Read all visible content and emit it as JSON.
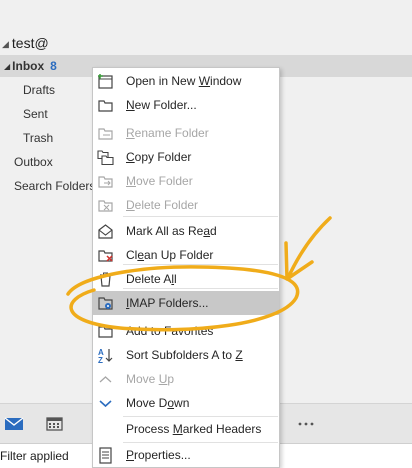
{
  "folders": {
    "account": "test@",
    "inbox_label": "Inbox",
    "inbox_count": "8",
    "drafts": "Drafts",
    "sent": "Sent",
    "trash": "Trash",
    "outbox": "Outbox",
    "search_folders": "Search Folders"
  },
  "status": {
    "filter": "Filter applied"
  },
  "menu": {
    "items": [
      {
        "pre": "Open in New ",
        "acc": "W",
        "post": "indow",
        "icon": "open-window-icon",
        "disabled": false
      },
      {
        "pre": "",
        "acc": "N",
        "post": "ew Folder...",
        "icon": "new-folder-icon",
        "disabled": false
      },
      {
        "pre": "",
        "acc": "R",
        "post": "ename Folder",
        "icon": "rename-folder-icon",
        "disabled": true
      },
      {
        "pre": "",
        "acc": "C",
        "post": "opy Folder",
        "icon": "copy-folder-icon",
        "disabled": false
      },
      {
        "pre": "",
        "acc": "M",
        "post": "ove Folder",
        "icon": "move-folder-icon",
        "disabled": true
      },
      {
        "pre": "",
        "acc": "D",
        "post": "elete Folder",
        "icon": "delete-folder-icon",
        "disabled": true
      },
      {
        "pre": "Mark All as Re",
        "acc": "a",
        "post": "d",
        "icon": "mark-read-icon",
        "disabled": false
      },
      {
        "pre": "Cl",
        "acc": "e",
        "post": "an Up Folder",
        "icon": "clean-up-icon",
        "disabled": false
      },
      {
        "pre": "Delete A",
        "acc": "l",
        "post": "l",
        "icon": "delete-all-icon",
        "disabled": false
      },
      {
        "pre": "",
        "acc": "I",
        "post": "MAP Folders...",
        "icon": "imap-folders-icon",
        "disabled": false
      },
      {
        "pre": "Add to Favorites",
        "acc": "",
        "post": "",
        "icon": "favorites-icon",
        "disabled": false
      },
      {
        "pre": "Sort Subfolders A to ",
        "acc": "Z",
        "post": "",
        "icon": "sort-az-icon",
        "disabled": false
      },
      {
        "pre": "Move ",
        "acc": "U",
        "post": "p",
        "icon": "chevron-up-icon",
        "disabled": true
      },
      {
        "pre": "Move D",
        "acc": "o",
        "post": "wn",
        "icon": "chevron-down-icon",
        "disabled": false
      },
      {
        "pre": "Process ",
        "acc": "M",
        "post": "arked Headers",
        "icon": "",
        "disabled": false
      },
      {
        "pre": "",
        "acc": "P",
        "post": "roperties...",
        "icon": "properties-icon",
        "disabled": false
      }
    ]
  },
  "colors": {
    "accent_blue": "#2b6cbf",
    "annotation_gold": "#f0ac1a",
    "highlight_gray": "#c8c8c8"
  }
}
